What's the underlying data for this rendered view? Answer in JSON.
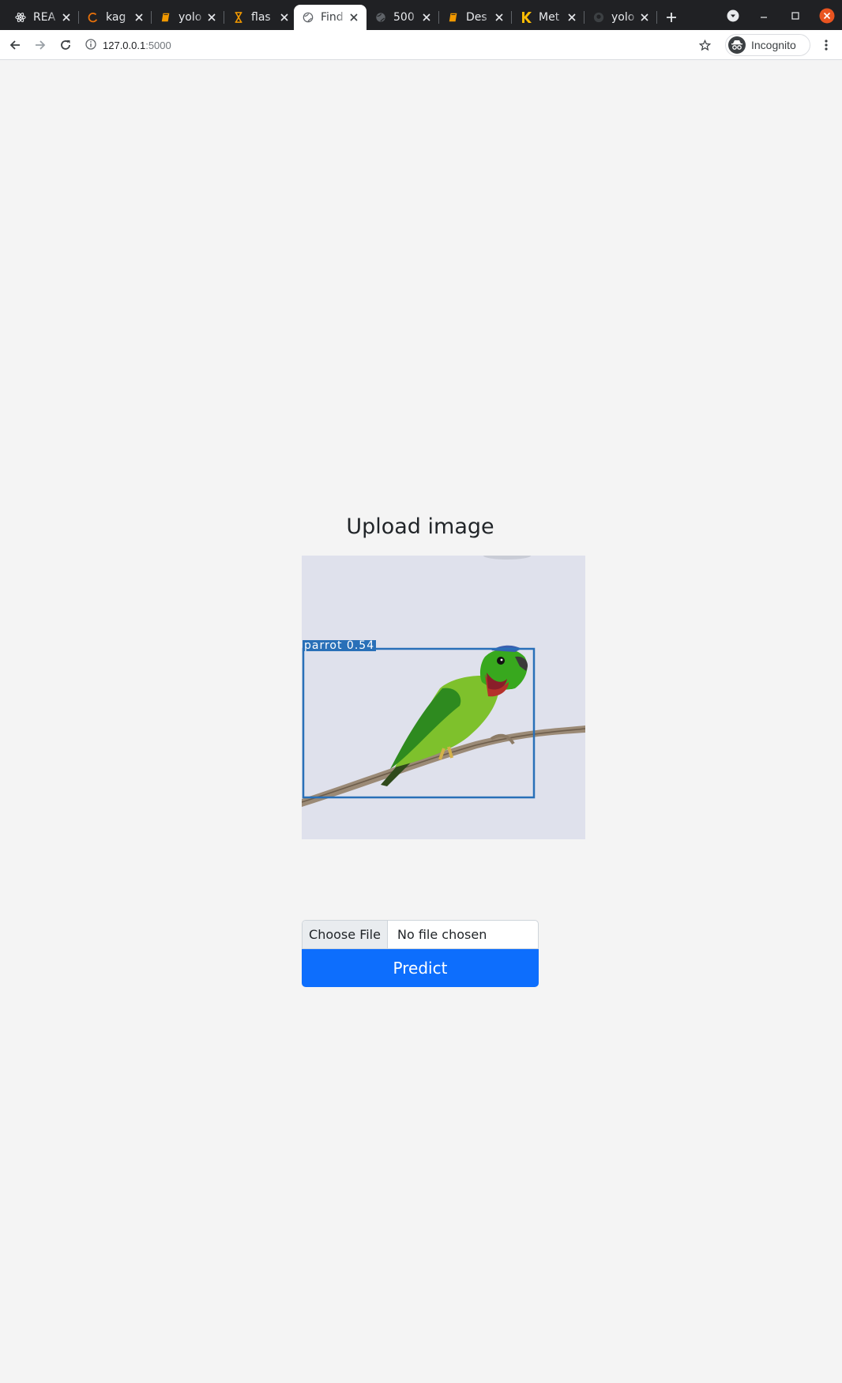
{
  "browser": {
    "tabs": [
      {
        "title": "REA",
        "icon": "react-icon",
        "active": false
      },
      {
        "title": "kag",
        "icon": "kaggle-icon",
        "active": false
      },
      {
        "title": "yolo",
        "icon": "book-icon",
        "active": false
      },
      {
        "title": "flas",
        "icon": "hourglass-icon",
        "active": false
      },
      {
        "title": "Find",
        "icon": "globe-icon",
        "active": true
      },
      {
        "title": "500",
        "icon": "globe-icon",
        "active": false
      },
      {
        "title": "Des",
        "icon": "book-icon",
        "active": false
      },
      {
        "title": "Met",
        "icon": "k-logo-icon",
        "active": false
      },
      {
        "title": "yolo",
        "icon": "github-icon",
        "active": false
      }
    ],
    "url_host": "127.0.0.1",
    "url_port": ":5000",
    "profile_label": "Incognito",
    "colors": {
      "tabstrip": "#202124",
      "close_window": "#e95420"
    }
  },
  "page": {
    "heading": "Upload image",
    "detection": {
      "label": "parrot 0.54",
      "box_color": "#2970b8"
    },
    "file_input": {
      "button_label": "Choose File",
      "status": "No file chosen"
    },
    "predict_label": "Predict",
    "colors": {
      "primary": "#0d6efd",
      "background": "#f4f4f4"
    }
  }
}
